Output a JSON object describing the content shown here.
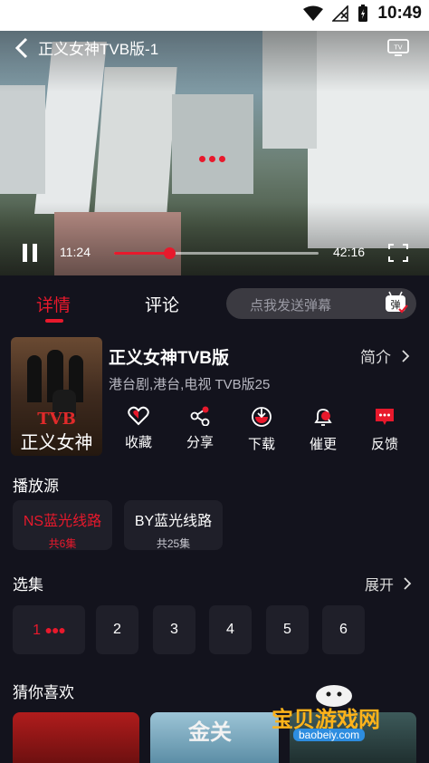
{
  "status_bar": {
    "time": "10:49"
  },
  "player": {
    "title": "正义女神TVB版-1",
    "current_time": "11:24",
    "total_time": "42:16",
    "progress": 0.27
  },
  "tabs": [
    {
      "label": "详情",
      "active": true
    },
    {
      "label": "评论",
      "active": false
    }
  ],
  "danmaku": {
    "placeholder": "点我发送弹幕",
    "icon_label": "弹"
  },
  "show": {
    "title": "正义女神TVB版",
    "intro_label": "简介",
    "tags": "港台剧,港台,电视 TVB版25",
    "poster_text_1": "TVB",
    "poster_text_2": "正义女神"
  },
  "actions": [
    {
      "label": "收藏",
      "icon": "heart-icon"
    },
    {
      "label": "分享",
      "icon": "share-icon"
    },
    {
      "label": "下载",
      "icon": "download-icon"
    },
    {
      "label": "催更",
      "icon": "bell-icon"
    },
    {
      "label": "反馈",
      "icon": "feedback-icon"
    }
  ],
  "source": {
    "title": "播放源",
    "items": [
      {
        "name": "NS蓝光线路",
        "count": "共6集",
        "active": true
      },
      {
        "name": "BY蓝光线路",
        "count": "共25集",
        "active": false
      }
    ]
  },
  "episodes": {
    "title": "选集",
    "expand_label": "展开",
    "items": [
      "1",
      "2",
      "3",
      "4",
      "5",
      "6"
    ]
  },
  "recommend": {
    "title": "猜你喜欢",
    "card_text": "金关"
  },
  "watermark": {
    "text": "宝贝游戏网",
    "url": "baobeiy.com"
  },
  "colors": {
    "accent": "#e8192c",
    "background": "#13131d",
    "card": "#1f1f29"
  }
}
